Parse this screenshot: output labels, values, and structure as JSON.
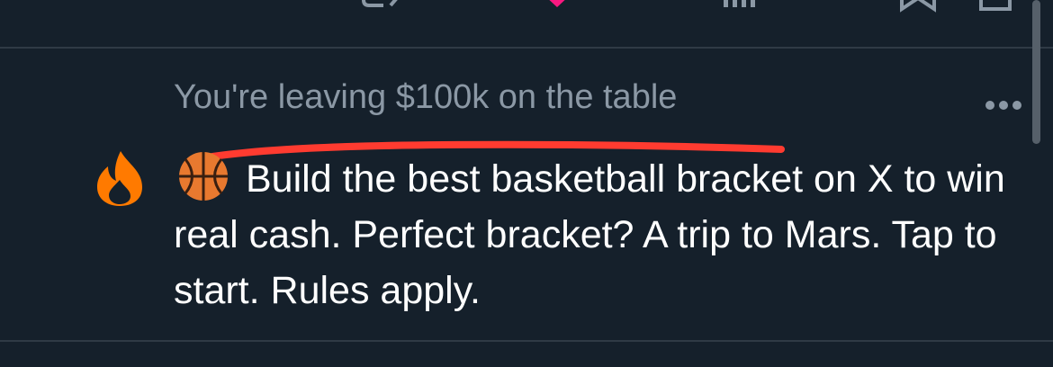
{
  "tweet_actions": {
    "icons": [
      "reply-icon",
      "retweet-icon",
      "like-icon",
      "views-icon",
      "bookmark-icon",
      "share-icon"
    ],
    "like_color": "#f91880"
  },
  "promo": {
    "header": "You're leaving $100k on the table",
    "body": "Build the best basketball bracket on X to win real cash. Perfect bracket? A trip to Mars. Tap to start. Rules apply.",
    "leading_icon": "fire-icon",
    "emoji_icon": "basketball-icon",
    "more_icon": "more-horizontal-icon",
    "annotation_color": "#ff3b30"
  }
}
